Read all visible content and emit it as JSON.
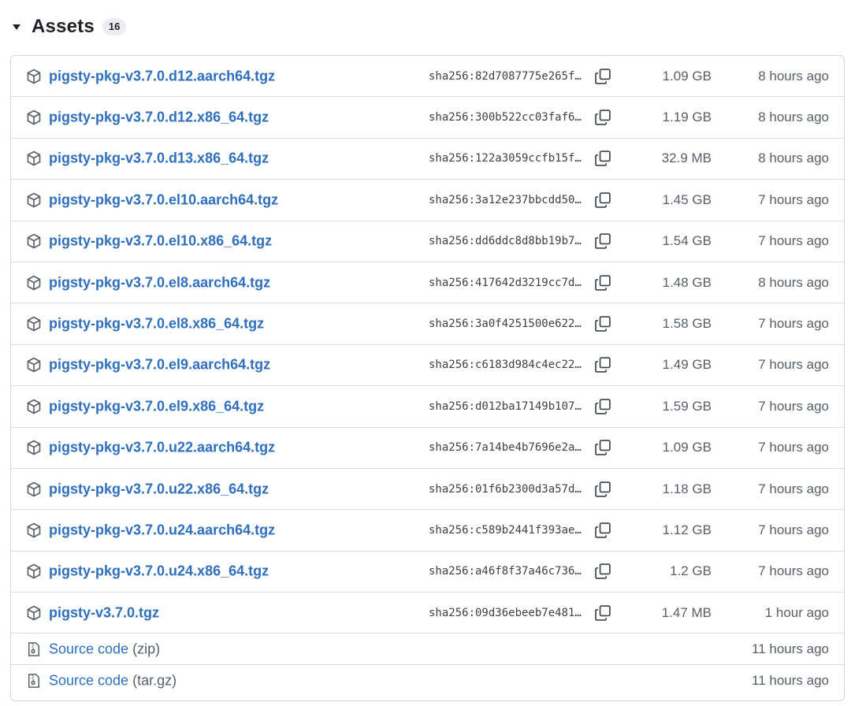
{
  "assets": {
    "title": "Assets",
    "count": "16",
    "caret_icon": "triangle-down-icon"
  },
  "packages": [
    {
      "name": "pigsty-pkg-v3.7.0.d12.aarch64.tgz",
      "sha": "sha256:82d7087775e265f…",
      "size": "1.09 GB",
      "time": "8 hours ago"
    },
    {
      "name": "pigsty-pkg-v3.7.0.d12.x86_64.tgz",
      "sha": "sha256:300b522cc03faf6…",
      "size": "1.19 GB",
      "time": "8 hours ago"
    },
    {
      "name": "pigsty-pkg-v3.7.0.d13.x86_64.tgz",
      "sha": "sha256:122a3059ccfb15f…",
      "size": "32.9 MB",
      "time": "8 hours ago"
    },
    {
      "name": "pigsty-pkg-v3.7.0.el10.aarch64.tgz",
      "sha": "sha256:3a12e237bbcdd50…",
      "size": "1.45 GB",
      "time": "7 hours ago"
    },
    {
      "name": "pigsty-pkg-v3.7.0.el10.x86_64.tgz",
      "sha": "sha256:dd6ddc8d8bb19b7…",
      "size": "1.54 GB",
      "time": "7 hours ago"
    },
    {
      "name": "pigsty-pkg-v3.7.0.el8.aarch64.tgz",
      "sha": "sha256:417642d3219cc7d…",
      "size": "1.48 GB",
      "time": "8 hours ago"
    },
    {
      "name": "pigsty-pkg-v3.7.0.el8.x86_64.tgz",
      "sha": "sha256:3a0f4251500e622…",
      "size": "1.58 GB",
      "time": "7 hours ago"
    },
    {
      "name": "pigsty-pkg-v3.7.0.el9.aarch64.tgz",
      "sha": "sha256:c6183d984c4ec22…",
      "size": "1.49 GB",
      "time": "7 hours ago"
    },
    {
      "name": "pigsty-pkg-v3.7.0.el9.x86_64.tgz",
      "sha": "sha256:d012ba17149b107…",
      "size": "1.59 GB",
      "time": "7 hours ago"
    },
    {
      "name": "pigsty-pkg-v3.7.0.u22.aarch64.tgz",
      "sha": "sha256:7a14be4b7696e2a…",
      "size": "1.09 GB",
      "time": "7 hours ago"
    },
    {
      "name": "pigsty-pkg-v3.7.0.u22.x86_64.tgz",
      "sha": "sha256:01f6b2300d3a57d…",
      "size": "1.18 GB",
      "time": "7 hours ago"
    },
    {
      "name": "pigsty-pkg-v3.7.0.u24.aarch64.tgz",
      "sha": "sha256:c589b2441f393ae…",
      "size": "1.12 GB",
      "time": "7 hours ago"
    },
    {
      "name": "pigsty-pkg-v3.7.0.u24.x86_64.tgz",
      "sha": "sha256:a46f8f37a46c736…",
      "size": "1.2 GB",
      "time": "7 hours ago"
    },
    {
      "name": "pigsty-v3.7.0.tgz",
      "sha": "sha256:09d36ebeeb7e481…",
      "size": "1.47 MB",
      "time": "1 hour ago"
    }
  ],
  "source_code": [
    {
      "label": "Source code",
      "ext": "(zip)",
      "time": "11 hours ago"
    },
    {
      "label": "Source code",
      "ext": "(tar.gz)",
      "time": "11 hours ago"
    }
  ],
  "icons": {
    "package": "package-icon",
    "copy": "copy-icon",
    "source": "file-zip-icon"
  },
  "colors": {
    "link": "#2f6fbe",
    "muted": "#57606a",
    "border": "#d0d7de"
  }
}
